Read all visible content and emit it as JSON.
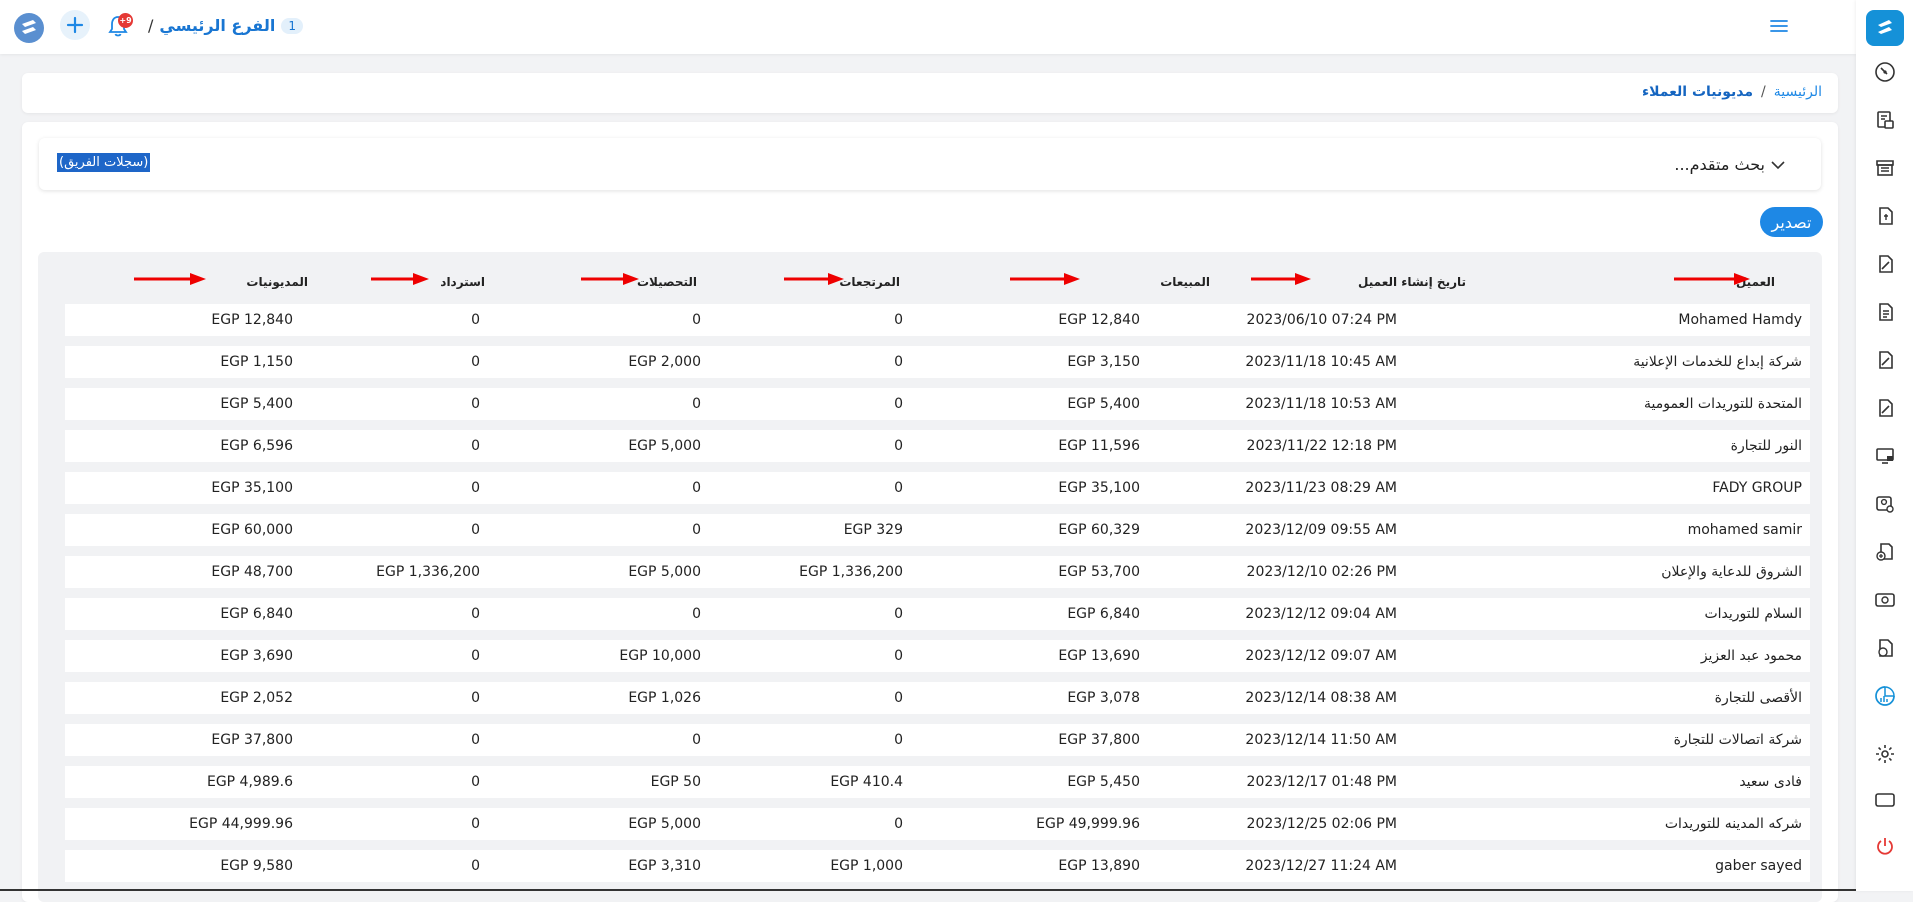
{
  "topbar": {
    "branch_number": "1",
    "branch_name": "الفرع الرئيسي",
    "separator": "/",
    "notifications_badge": "+9"
  },
  "breadcrumb": {
    "home": "الرئيسية",
    "separator": "/",
    "current": "مديونيات العملاء"
  },
  "search": {
    "advanced_label": "بحث متقدم...",
    "team_records_label": "(سجلات الفريق)"
  },
  "actions": {
    "export_label": "تصدير"
  },
  "table": {
    "headers": {
      "customer": "العميل",
      "created": "تاريخ إنشاء العميل",
      "sales": "المبيعات",
      "returns": "المرتجعات",
      "collections": "التحصيلات",
      "refund": "استرداد",
      "debts": "المديونيات"
    },
    "rows": [
      {
        "customer": "Mohamed Hamdy",
        "created": "2023/06/10 07:24 PM",
        "sales": "EGP 12,840",
        "returns": "0",
        "collections": "0",
        "refund": "0",
        "debts": "EGP 12,840"
      },
      {
        "customer": "شركة إبداع للخدمات الإعلانية",
        "created": "2023/11/18 10:45 AM",
        "sales": "EGP 3,150",
        "returns": "0",
        "collections": "EGP 2,000",
        "refund": "0",
        "debts": "EGP 1,150"
      },
      {
        "customer": "المتحدة للتوريدات العمومية",
        "created": "2023/11/18 10:53 AM",
        "sales": "EGP 5,400",
        "returns": "0",
        "collections": "0",
        "refund": "0",
        "debts": "EGP 5,400"
      },
      {
        "customer": "النور للتجارة",
        "created": "2023/11/22 12:18 PM",
        "sales": "EGP 11,596",
        "returns": "0",
        "collections": "EGP 5,000",
        "refund": "0",
        "debts": "EGP 6,596"
      },
      {
        "customer": "FADY GROUP",
        "created": "2023/11/23 08:29 AM",
        "sales": "EGP 35,100",
        "returns": "0",
        "collections": "0",
        "refund": "0",
        "debts": "EGP 35,100"
      },
      {
        "customer": "mohamed samir",
        "created": "2023/12/09 09:55 AM",
        "sales": "EGP 60,329",
        "returns": "EGP 329",
        "collections": "0",
        "refund": "0",
        "debts": "EGP 60,000"
      },
      {
        "customer": "الشروق للدعاية والإعلان",
        "created": "2023/12/10 02:26 PM",
        "sales": "EGP 53,700",
        "returns": "EGP 1,336,200",
        "collections": "EGP 5,000",
        "refund": "EGP 1,336,200",
        "debts": "EGP 48,700"
      },
      {
        "customer": "السلام للتوريدات",
        "created": "2023/12/12 09:04 AM",
        "sales": "EGP 6,840",
        "returns": "0",
        "collections": "0",
        "refund": "0",
        "debts": "EGP 6,840"
      },
      {
        "customer": "محمود عبد العزيز",
        "created": "2023/12/12 09:07 AM",
        "sales": "EGP 13,690",
        "returns": "0",
        "collections": "EGP 10,000",
        "refund": "0",
        "debts": "EGP 3,690"
      },
      {
        "customer": "الأقصى للتجارة",
        "created": "2023/12/14 08:38 AM",
        "sales": "EGP 3,078",
        "returns": "0",
        "collections": "EGP 1,026",
        "refund": "0",
        "debts": "EGP 2,052"
      },
      {
        "customer": "شركة اتصالات للتجارة",
        "created": "2023/12/14 11:50 AM",
        "sales": "EGP 37,800",
        "returns": "0",
        "collections": "0",
        "refund": "0",
        "debts": "EGP 37,800"
      },
      {
        "customer": "فادى سعيد",
        "created": "2023/12/17 01:48 PM",
        "sales": "EGP 5,450",
        "returns": "EGP 410.4",
        "collections": "EGP 50",
        "refund": "0",
        "debts": "EGP 4,989.6"
      },
      {
        "customer": "شركه المدينه للتوريدات",
        "created": "2023/12/25 02:06 PM",
        "sales": "EGP 49,999.96",
        "returns": "0",
        "collections": "EGP 5,000",
        "refund": "0",
        "debts": "EGP 44,999.96"
      },
      {
        "customer": "gaber sayed",
        "created": "2023/12/27 11:24 AM",
        "sales": "EGP 13,890",
        "returns": "EGP 1,000",
        "collections": "EGP 3,310",
        "refund": "0",
        "debts": "EGP 9,580"
      }
    ]
  },
  "sidebar": {
    "items": [
      {
        "icon": "dashboard-gauge-icon"
      },
      {
        "icon": "invoice-print-icon"
      },
      {
        "icon": "store-icon"
      },
      {
        "icon": "document-money-icon"
      },
      {
        "icon": "document-edit-icon"
      },
      {
        "icon": "document-list-icon"
      },
      {
        "icon": "document-edit-2-icon"
      },
      {
        "icon": "document-edit-3-icon"
      },
      {
        "icon": "monitor-icon"
      },
      {
        "icon": "users-settings-icon"
      },
      {
        "icon": "add-document-icon"
      },
      {
        "icon": "cash-icon"
      },
      {
        "icon": "person-money-icon"
      },
      {
        "icon": "reports-chart-icon"
      },
      {
        "icon": "settings-gear-icon"
      },
      {
        "icon": "window-icon"
      },
      {
        "icon": "power-icon"
      }
    ]
  },
  "colors": {
    "accent": "#1e88e5",
    "active_sidebar": "#1591d8",
    "logout": "#e53935"
  }
}
